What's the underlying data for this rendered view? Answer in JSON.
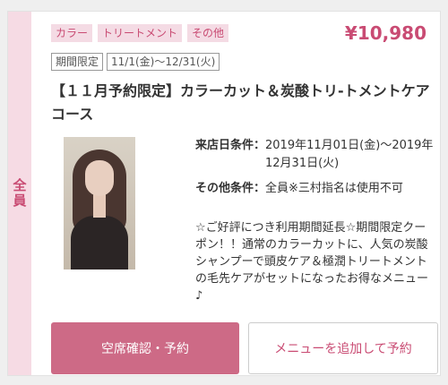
{
  "side_badge": "全員",
  "tags": [
    "カラー",
    "トリートメント",
    "その他"
  ],
  "price": "¥10,980",
  "period": {
    "label": "期間限定",
    "dates": "11/1(金)〜12/31(火)"
  },
  "title": "【１１月予約限定】カラーカット＆炭酸トリ-トメントケアコース",
  "conditions": {
    "visit_label": "来店日条件：",
    "visit_value": "2019年11月01日(金)〜2019年12月31日(火)",
    "other_label": "その他条件：",
    "other_value": "全員※三村指名は使用不可"
  },
  "description": "☆ご好評につき利用期間延長☆期間限定クーポン！！通常のカラーカットに、人気の炭酸シャンプーで頭皮ケア＆極潤トリートメントの毛先ケアがセットになったお得なメニュー♪",
  "buttons": {
    "primary": "空席確認・予約",
    "secondary": "メニューを追加して予約"
  },
  "colors": {
    "accent": "#c94b73",
    "button": "#cd6a86",
    "tag_bg": "#f4dbe4"
  }
}
